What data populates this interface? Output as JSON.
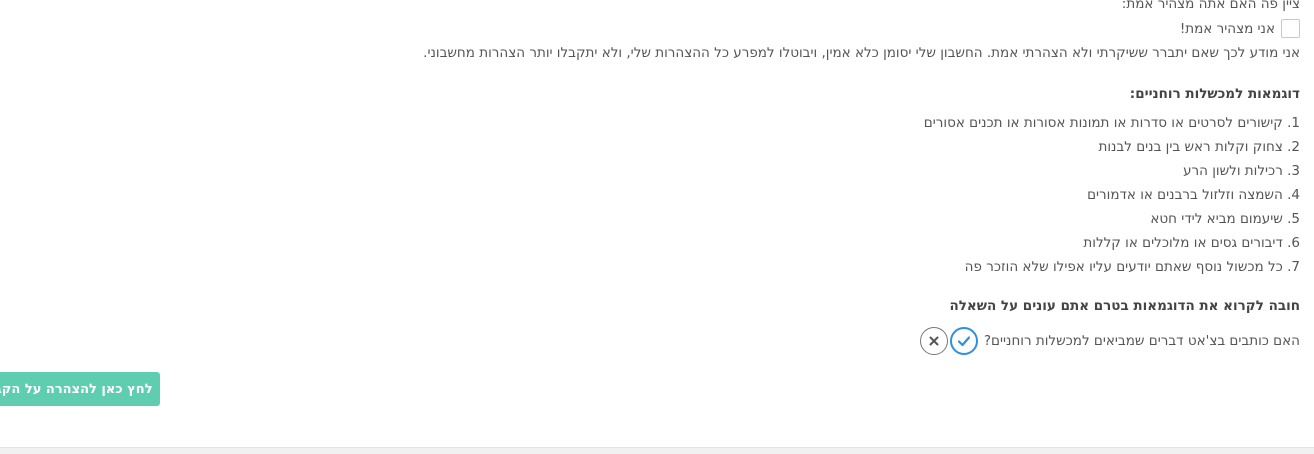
{
  "declaration": {
    "prompt": "ציין פה האם אתה מצהיר אמת:",
    "checkbox_label": "אני מצהיר אמת!",
    "notice": "אני מודע לכך שאם יתברר ששיקרתי ולא הצהרתי אמת. החשבון שלי יסומן כלא אמין, ויבוטלו למפרע כל ההצהרות שלי, ולא יתקבלו יותר הצהרות מחשבוני."
  },
  "examples": {
    "heading": "דוגמאות למכשלות רוחניים:",
    "items": [
      "1. קישורים לסרטים או סדרות או תמונות אסורות או תכנים אסורים",
      "2. צחוק וקלות ראש בין בנים לבנות",
      "3. רכילות ולשון הרע",
      "4. השמצה וזלזול ברבנים או אדמורים",
      "5. שיעמום מביא לידי חטא",
      "6. דיבורים גסים או מלוכלים או קללות",
      "7. כל מכשול נוסף שאתם יודעים עליו אפילו שלא הוזכר פה"
    ]
  },
  "question": {
    "must_read": "חובה לקרוא את הדוגמאות בטרם אתם עונים על השאלה",
    "text": "האם כותבים בצ'אט דברים שמביאים למכשלות רוחניים?",
    "yes_icon": "check-icon",
    "no_icon": "close-icon"
  },
  "actions": {
    "declare_label": "לחץ כאן להצהרה על הקבוצה",
    "declare_color": "#5fcdb0"
  }
}
